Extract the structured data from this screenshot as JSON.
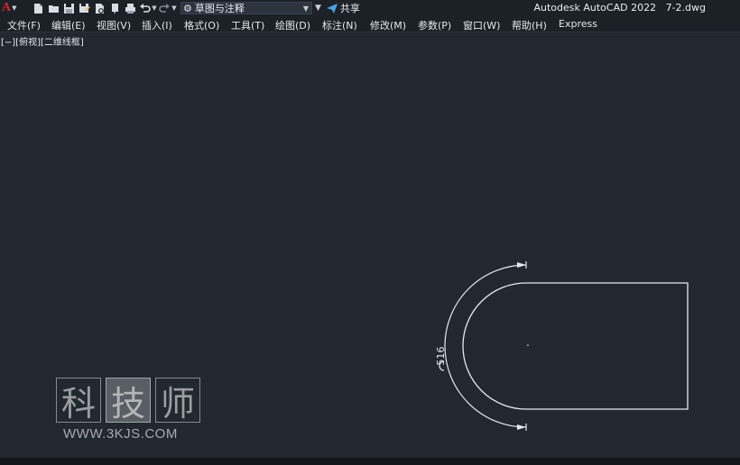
{
  "app": {
    "title": "Autodesk AutoCAD 2022",
    "file": "7-2.dwg",
    "logo_letter": "A"
  },
  "qat": {
    "workspace": "草图与注释",
    "share_label": "共享",
    "icons": [
      "new-icon",
      "open-icon",
      "save-icon",
      "save-as-icon",
      "plot-preview-icon",
      "publish-icon",
      "print-icon",
      "undo-icon",
      "redo-icon"
    ]
  },
  "menu": {
    "items": [
      "文件(F)",
      "编辑(E)",
      "视图(V)",
      "插入(I)",
      "格式(O)",
      "工具(T)",
      "绘图(D)",
      "标注(N)",
      "修改(M)",
      "参数(P)",
      "窗口(W)",
      "帮助(H)",
      "Express"
    ]
  },
  "viewport": {
    "label": "[−][俯视][二维线框]"
  },
  "drawing": {
    "dimension_text": "516"
  },
  "watermark": {
    "chars": [
      "科",
      "技",
      "师"
    ],
    "url": "WWW.3KJS.COM"
  },
  "colors": {
    "background": "#212830",
    "linework": "#e6e9ec",
    "share_icon": "#4aa3df",
    "logo": "#d9262c"
  }
}
